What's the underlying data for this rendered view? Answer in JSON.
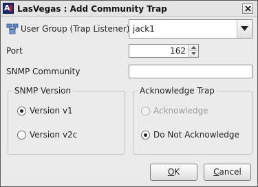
{
  "window": {
    "title": "LasVegas : Add Community Trap",
    "app_icon_letter": "A"
  },
  "form": {
    "user_group_label": "User Group (Trap Listener)",
    "user_group_value": "jack1",
    "port_label": "Port",
    "port_value": "162",
    "community_label": "SNMP Community",
    "community_value": ""
  },
  "snmp_version": {
    "title": "SNMP Version",
    "options": [
      {
        "label": "Version v1",
        "selected": true
      },
      {
        "label": "Version v2c",
        "selected": false
      }
    ]
  },
  "acknowledge_trap": {
    "title": "Acknowledge Trap",
    "options": [
      {
        "label": "Acknowledge",
        "selected": false,
        "enabled": false
      },
      {
        "label": "Do Not Acknowledge",
        "selected": true,
        "enabled": true
      }
    ]
  },
  "buttons": {
    "ok_mnemonic": "O",
    "ok_rest": "K",
    "cancel_mnemonic": "C",
    "cancel_rest": "ancel"
  },
  "icons": {
    "app": "app-logo-icon",
    "close": "close-icon",
    "user_group": "user-group-icon",
    "dropdown": "chevron-down-icon",
    "spin_up": "spin-up-icon",
    "spin_down": "spin-down-icon"
  }
}
